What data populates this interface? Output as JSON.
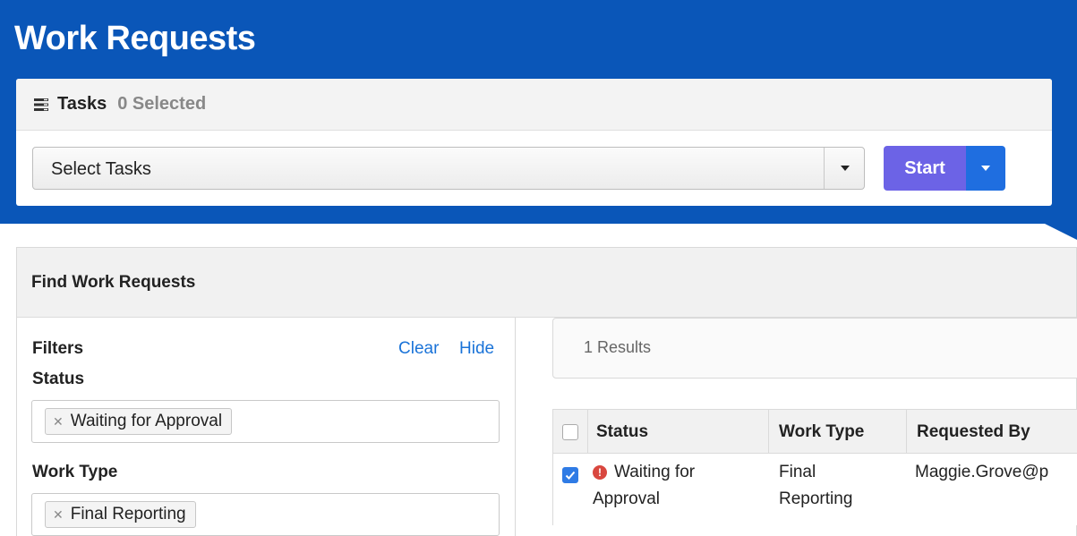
{
  "page": {
    "title": "Work Requests"
  },
  "tasks": {
    "label": "Tasks",
    "selected_text": "0 Selected",
    "select_value": "Select Tasks",
    "start_label": "Start"
  },
  "find": {
    "title": "Find Work Requests",
    "filters": {
      "title": "Filters",
      "clear_label": "Clear",
      "hide_label": "Hide",
      "status_label": "Status",
      "status_tag": "Waiting for Approval",
      "work_type_label": "Work Type",
      "work_type_tag": "Final Reporting"
    },
    "results": {
      "summary": "1 Results",
      "columns": [
        "Status",
        "Work Type",
        "Requested By"
      ],
      "rows": [
        {
          "checked": true,
          "status_line1": "Waiting for",
          "status_line2": "Approval",
          "work_type_line1": "Final",
          "work_type_line2": "Reporting",
          "requested_by": "Maggie.Grove@p"
        }
      ]
    }
  },
  "colors": {
    "header_blue": "#0a56b8",
    "start_button": "#6c63e6",
    "start_dropdown": "#1f6ee0",
    "link": "#1a73d8",
    "warning": "#d9473f"
  },
  "icons": {
    "tasks": "tasks-list-icon",
    "status_warning": "exclamation-circle-icon",
    "tag_remove": "remove-x-icon",
    "caret": "caret-down-icon"
  }
}
